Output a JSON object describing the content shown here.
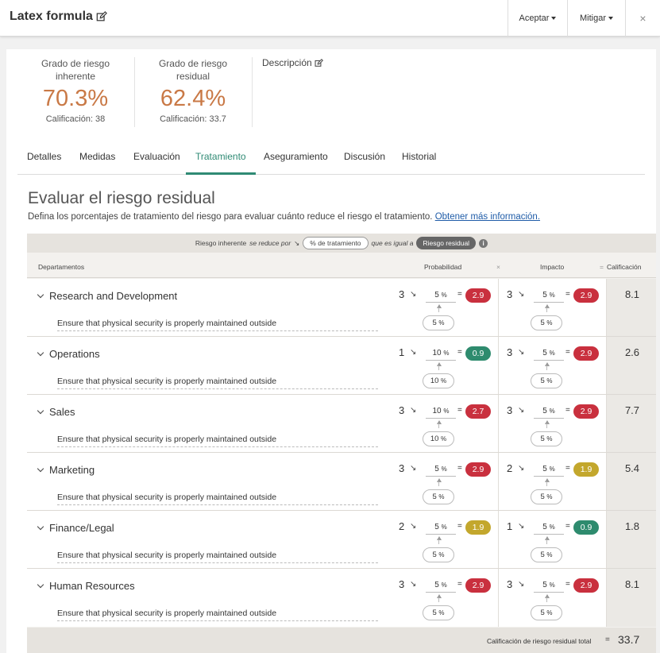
{
  "header": {
    "title": "Latex formula",
    "accept_label": "Aceptar",
    "mitigate_label": "Mitigar",
    "close_symbol": "×"
  },
  "summary": {
    "inherent_label": "Grado de riesgo inherente",
    "inherent_value": "70.3%",
    "inherent_rating": "Calificación: 38",
    "residual_label": "Grado de riesgo residual",
    "residual_value": "62.4%",
    "residual_rating": "Calificación: 33.7",
    "description_label": "Descripción"
  },
  "tabs": [
    "Detalles",
    "Medidas",
    "Evaluación",
    "Tratamiento",
    "Aseguramiento",
    "Discusión",
    "Historial"
  ],
  "active_tab": "Tratamiento",
  "section": {
    "title": "Evaluar el riesgo residual",
    "subtitle": "Defina los porcentajes de tratamiento del riesgo para evaluar cuánto reduce el riesgo el tratamiento.",
    "link": "Obtener más información."
  },
  "formula": {
    "inherent": "Riesgo inherente",
    "reduced_by": "se reduce por",
    "treatment_pill": "% de tratamiento",
    "equals": "que es igual a",
    "residual_pill": "Riesgo residual",
    "info": "i"
  },
  "columns": {
    "departments": "Departamentos",
    "probability": "Probabilidad",
    "times": "×",
    "impact": "Impacto",
    "equals": "=",
    "rating": "Calificación"
  },
  "colors": {
    "red": "#c9303e",
    "green": "#2e8b6e",
    "yellow": "#c3a72d",
    "accent": "#2f8a74",
    "value_orange": "#c97946"
  },
  "rows": [
    {
      "dept": "Research and Development",
      "measure": "Ensure that physical security is properly maintained outside",
      "prob": {
        "score": "3",
        "pct": "5",
        "pct_bottom": "5",
        "result": "2.9",
        "color": "red"
      },
      "impact": {
        "score": "3",
        "pct": "5",
        "pct_bottom": "5",
        "result": "2.9",
        "color": "red"
      },
      "rating": "8.1"
    },
    {
      "dept": "Operations",
      "measure": "Ensure that physical security is properly maintained outside",
      "prob": {
        "score": "1",
        "pct": "10",
        "pct_bottom": "10",
        "result": "0.9",
        "color": "green"
      },
      "impact": {
        "score": "3",
        "pct": "5",
        "pct_bottom": "5",
        "result": "2.9",
        "color": "red"
      },
      "rating": "2.6"
    },
    {
      "dept": "Sales",
      "measure": "Ensure that physical security is properly maintained outside",
      "prob": {
        "score": "3",
        "pct": "10",
        "pct_bottom": "10",
        "result": "2.7",
        "color": "red"
      },
      "impact": {
        "score": "3",
        "pct": "5",
        "pct_bottom": "5",
        "result": "2.9",
        "color": "red"
      },
      "rating": "7.7"
    },
    {
      "dept": "Marketing",
      "measure": "Ensure that physical security is properly maintained outside",
      "prob": {
        "score": "3",
        "pct": "5",
        "pct_bottom": "5",
        "result": "2.9",
        "color": "red"
      },
      "impact": {
        "score": "2",
        "pct": "5",
        "pct_bottom": "5",
        "result": "1.9",
        "color": "yellow"
      },
      "rating": "5.4"
    },
    {
      "dept": "Finance/Legal",
      "measure": "Ensure that physical security is properly maintained outside",
      "prob": {
        "score": "2",
        "pct": "5",
        "pct_bottom": "5",
        "result": "1.9",
        "color": "yellow"
      },
      "impact": {
        "score": "1",
        "pct": "5",
        "pct_bottom": "5",
        "result": "0.9",
        "color": "green"
      },
      "rating": "1.8"
    },
    {
      "dept": "Human Resources",
      "measure": "Ensure that physical security is properly maintained outside",
      "prob": {
        "score": "3",
        "pct": "5",
        "pct_bottom": "5",
        "result": "2.9",
        "color": "red"
      },
      "impact": {
        "score": "3",
        "pct": "5",
        "pct_bottom": "5",
        "result": "2.9",
        "color": "red"
      },
      "rating": "8.1"
    }
  ],
  "total": {
    "label": "Calificación de riesgo residual total",
    "equals": "=",
    "value": "33.7"
  }
}
